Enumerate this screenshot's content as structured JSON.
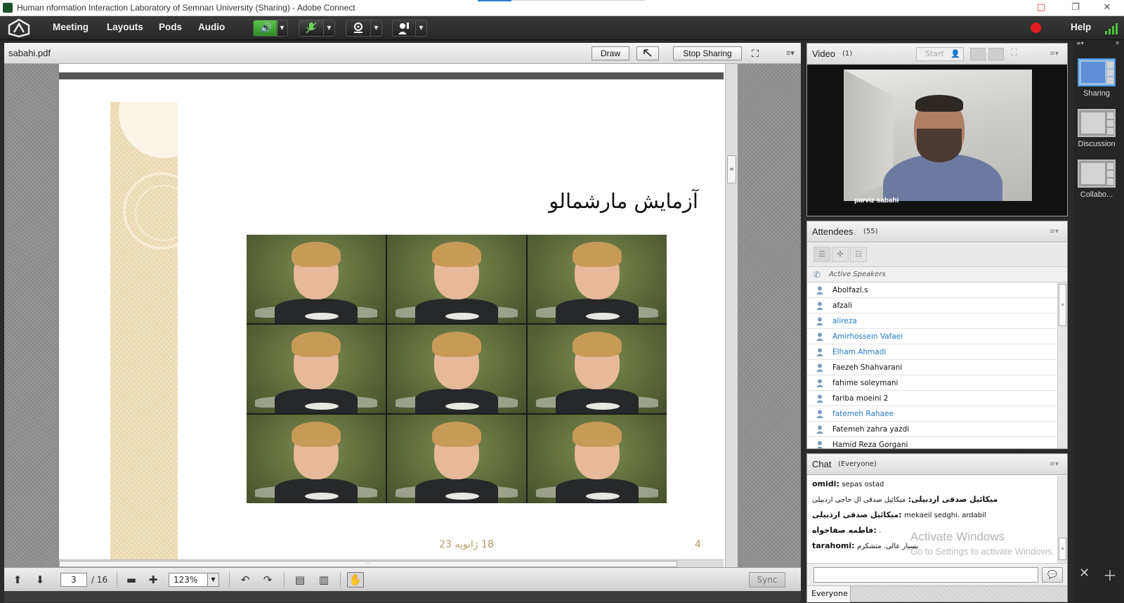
{
  "window": {
    "title": "Human nformation Interaction Laboratory of Semnan University (Sharing) - Adobe Connect",
    "controls": {
      "minimize": "□",
      "maximize": "❐",
      "close": "✕"
    }
  },
  "menubar": {
    "items": [
      "Meeting",
      "Layouts",
      "Pods",
      "Audio"
    ],
    "help": "Help",
    "colors": {
      "speaker_active": "#3fa832",
      "record": "#e01e1e"
    }
  },
  "share_pod": {
    "title": "sabahi.pdf",
    "buttons": {
      "draw": "Draw",
      "stop_sharing": "Stop Sharing"
    },
    "slide": {
      "heading": "آزمایش مارشمالو",
      "date": "18 ژانویه 23",
      "page_number": "4"
    },
    "footer": {
      "page": "3",
      "total": "/ 16",
      "zoom": "123%",
      "sync": "Sync"
    }
  },
  "video_pod": {
    "title": "Video",
    "count": "(1)",
    "start_label": "Start",
    "participant_name": "parviz sabahi"
  },
  "attendees_pod": {
    "title": "Attendees",
    "count": "(55)",
    "active_speakers_label": "Active Speakers",
    "attendees": [
      {
        "name": "Abolfazl.s",
        "highlight": false
      },
      {
        "name": "afzali",
        "highlight": false
      },
      {
        "name": "alireza",
        "highlight": true
      },
      {
        "name": "Amirhossein Vafaei",
        "highlight": true
      },
      {
        "name": "Elham Ahmadi",
        "highlight": true
      },
      {
        "name": "Faezeh Shahvarani",
        "highlight": false
      },
      {
        "name": "fahime soleymani",
        "highlight": false
      },
      {
        "name": "fariba moeini 2",
        "highlight": false
      },
      {
        "name": "fatemeh Rahaee",
        "highlight": true
      },
      {
        "name": "Fatemeh zahra yazdi",
        "highlight": false
      },
      {
        "name": "Hamid Reza Gorgani",
        "highlight": false
      }
    ]
  },
  "chat_pod": {
    "title": "Chat",
    "audience": "(Everyone)",
    "messages": [
      {
        "sender": "omidi:",
        "text": "sepas ostad"
      },
      {
        "sender": "میکائیل صدقی اردبیلی:",
        "text": "میکائیل صدقی ال حاجی اردبیلی"
      },
      {
        "sender": "میکائیل صدقی اردبیلی:",
        "text": "mekaeil sedghi. ardabil"
      },
      {
        "sender": "فاطمه صفاخواه:",
        "text": "."
      },
      {
        "sender": "tarahomi:",
        "text": "بسیار عالی. متشکرم"
      }
    ],
    "watermark_title": "Activate Windows",
    "watermark_sub": "Go to Settings to activate Windows.",
    "input_value": "",
    "send_to": "Everyone"
  },
  "layouts": [
    {
      "label": "Sharing",
      "active": true
    },
    {
      "label": "Discussion",
      "active": false
    },
    {
      "label": "Collabo...",
      "active": false
    }
  ]
}
